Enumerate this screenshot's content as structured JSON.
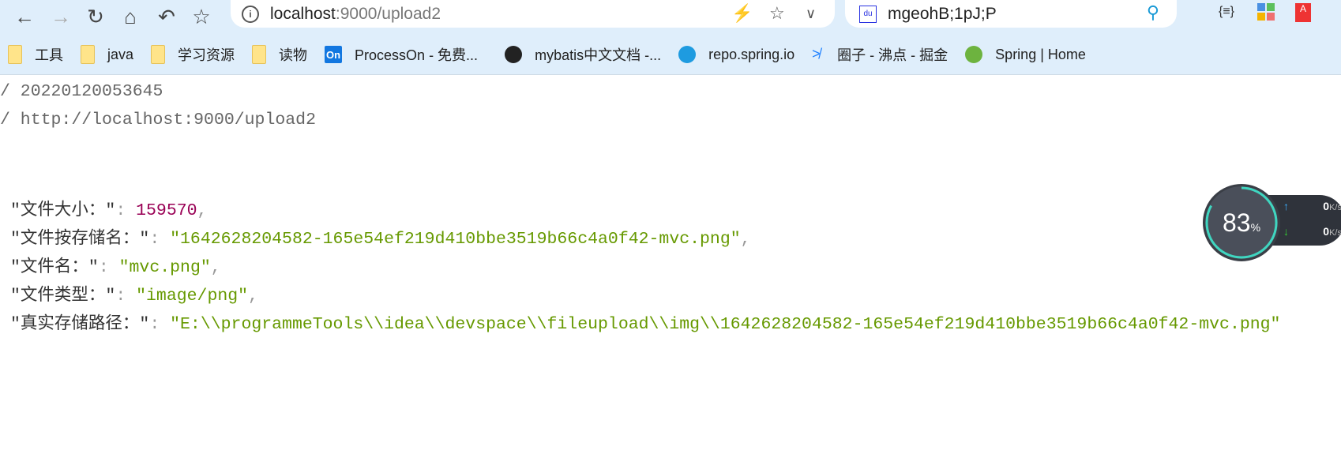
{
  "browser": {
    "address": {
      "host": "localhost",
      "path": ":9000/upload2"
    },
    "search": {
      "engine_icon": "baidu-icon",
      "query": "mgeohB;1pJ;P"
    },
    "extensions": [
      "json-viewer-icon",
      "apps-grid-icon",
      "pdf-icon"
    ],
    "bookmarks": [
      {
        "label": "工具",
        "icon": "folder"
      },
      {
        "label": "java",
        "icon": "folder"
      },
      {
        "label": "学习资源",
        "icon": "folder"
      },
      {
        "label": "读物",
        "icon": "folder"
      },
      {
        "label": "ProcessOn - 免费...",
        "icon": "processon",
        "icon_text": "On"
      },
      {
        "label": "mybatis中文文档 -...",
        "icon": "mybatis"
      },
      {
        "label": "repo.spring.io",
        "icon": "globe"
      },
      {
        "label": "圈子 - 沸点 - 掘金",
        "icon": "juejin"
      },
      {
        "label": "Spring | Home",
        "icon": "spring"
      }
    ]
  },
  "page": {
    "header_lines": [
      "/ 20220120053645",
      "/ http://localhost:9000/upload2"
    ],
    "json": [
      {
        "key": "\"文件大小：\"",
        "value": "159570",
        "type": "number",
        "trail": ","
      },
      {
        "key": "\"文件按存储名：\"",
        "value": "\"1642628204582-165e54ef219d410bbe3519b66c4a0f42-mvc.png\"",
        "type": "string",
        "trail": ","
      },
      {
        "key": "\"文件名：\"",
        "value": "\"mvc.png\"",
        "type": "string",
        "trail": ","
      },
      {
        "key": "\"文件类型：\"",
        "value": "\"image/png\"",
        "type": "string",
        "trail": ","
      },
      {
        "key": "\"真实存储路径：\"",
        "value": "\"E:\\\\programmeTools\\\\idea\\\\devspace\\\\fileupload\\\\img\\\\1642628204582-165e54ef219d410bbe3519b66c4a0f42-mvc.png\"",
        "type": "string",
        "trail": ""
      }
    ],
    "colon": ": "
  },
  "widget": {
    "percent": "83",
    "unit": "%",
    "up": "0",
    "down": "0",
    "speed_unit": "K/s",
    "percent_value": 83
  },
  "colors": {
    "number": "#990055",
    "string": "#669900",
    "chrome_bg": "#dfeefb"
  }
}
